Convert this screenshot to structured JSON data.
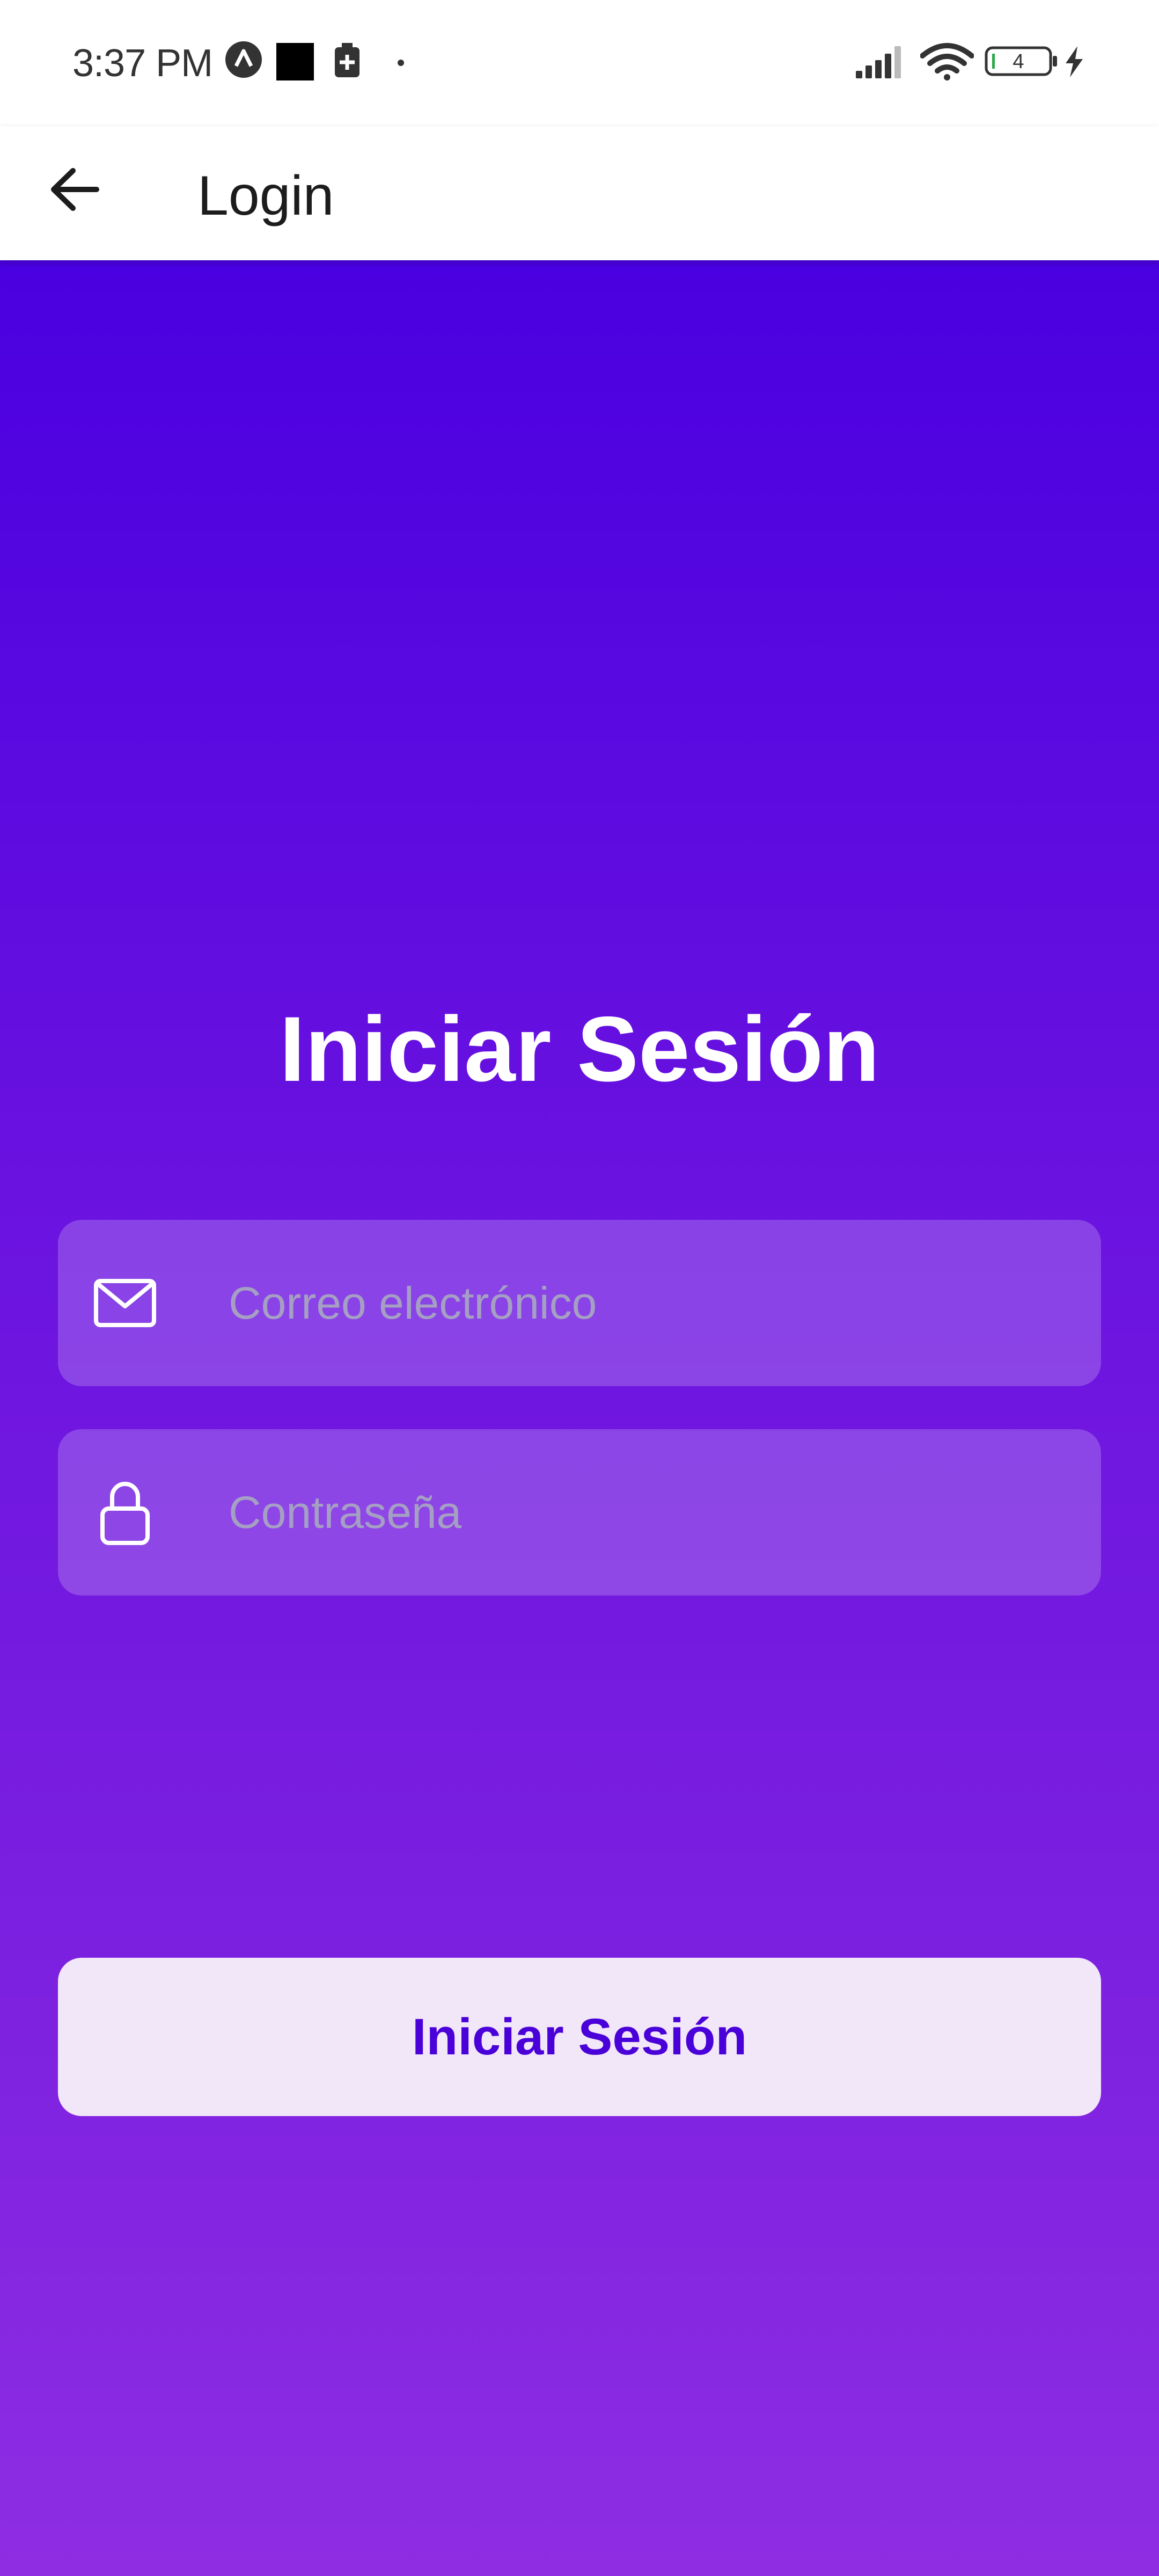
{
  "status_bar": {
    "time": "3:37 PM",
    "battery_level": "4",
    "icons": [
      "app-notification-icon",
      "black-square-icon",
      "battery-saver-icon",
      "dot-icon",
      "signal-icon",
      "wifi-icon",
      "battery-icon",
      "charging-bolt-icon"
    ]
  },
  "app_bar": {
    "title": "Login",
    "back_icon": "arrow-left-icon"
  },
  "login": {
    "heading": "Iniciar Sesión",
    "email": {
      "placeholder": "Correo electrónico",
      "value": "",
      "icon": "envelope-icon"
    },
    "password": {
      "placeholder": "Contraseña",
      "value": "",
      "icon": "lock-icon"
    },
    "submit_label": "Iniciar Sesión"
  },
  "colors": {
    "gradient_top": "#4a00e0",
    "gradient_bottom": "#8e2de2",
    "button_background": "#f1e7f8",
    "button_text": "#4a00d8"
  }
}
